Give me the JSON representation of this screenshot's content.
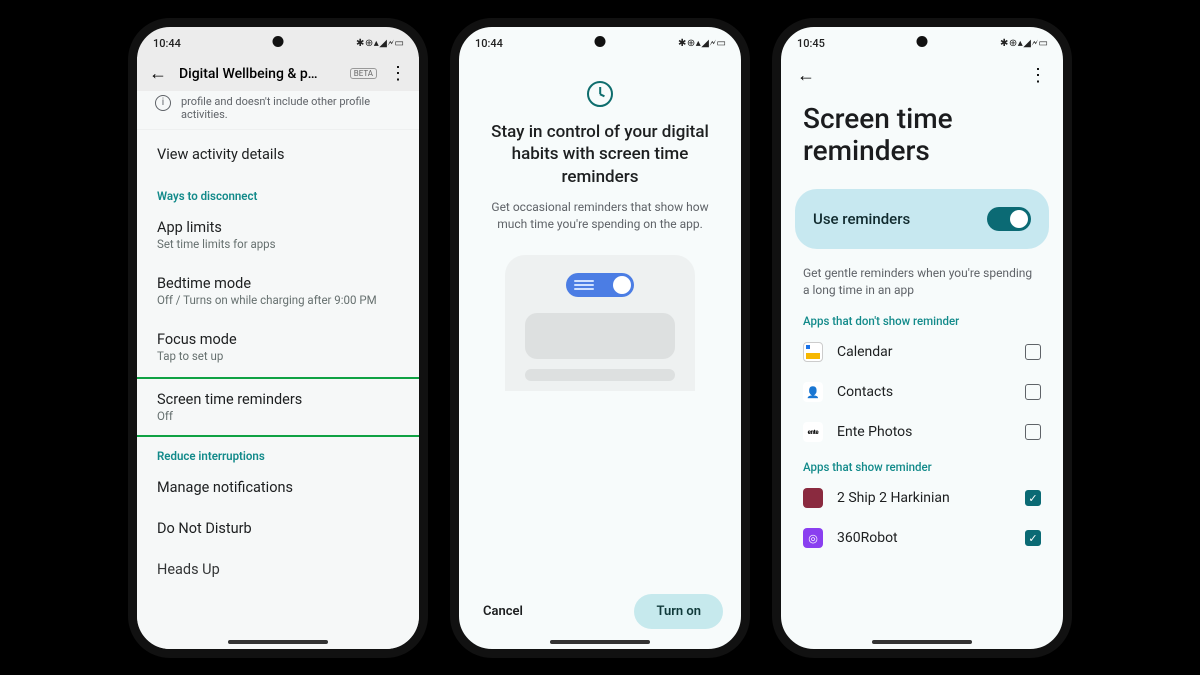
{
  "phone1": {
    "time": "10:44",
    "status_icons": "✱ ⊕ ▴ ◢ 🗲 ▭",
    "header_title": "Digital Wellbeing & p…",
    "beta_label": "BETA",
    "partial_note": "profile and doesn't include other profile activities.",
    "view_activity": "View activity details",
    "section_disconnect": "Ways to disconnect",
    "app_limits": {
      "title": "App limits",
      "sub": "Set time limits for apps"
    },
    "bedtime": {
      "title": "Bedtime mode",
      "sub": "Off / Turns on while charging after 9:00 PM"
    },
    "focus": {
      "title": "Focus mode",
      "sub": "Tap to set up"
    },
    "str": {
      "title": "Screen time reminders",
      "sub": "Off"
    },
    "section_reduce": "Reduce interruptions",
    "manage_notif": "Manage notifications",
    "dnd": "Do Not Disturb",
    "heads_up": "Heads Up"
  },
  "phone2": {
    "time": "10:44",
    "status_icons": "✱ ⊕ ▴ ◢ 🗲 ▭",
    "title": "Stay in control of your digital habits with screen time reminders",
    "sub": "Get occasional reminders that show how much time you're spending on the app.",
    "cancel": "Cancel",
    "turn_on": "Turn on"
  },
  "phone3": {
    "time": "10:45",
    "status_icons": "✱ ⊕ ▴ ◢ 🗲 ▭",
    "title": "Screen time reminders",
    "card_label": "Use reminders",
    "desc": "Get gentle reminders when you're spending a long time in an app",
    "section_no": "Apps that don't show reminder",
    "section_yes": "Apps that show reminder",
    "apps_no": [
      {
        "name": "Calendar"
      },
      {
        "name": "Contacts"
      },
      {
        "name": "Ente Photos"
      }
    ],
    "apps_yes": [
      {
        "name": "2 Ship 2 Harkinian"
      },
      {
        "name": "360Robot"
      }
    ]
  }
}
